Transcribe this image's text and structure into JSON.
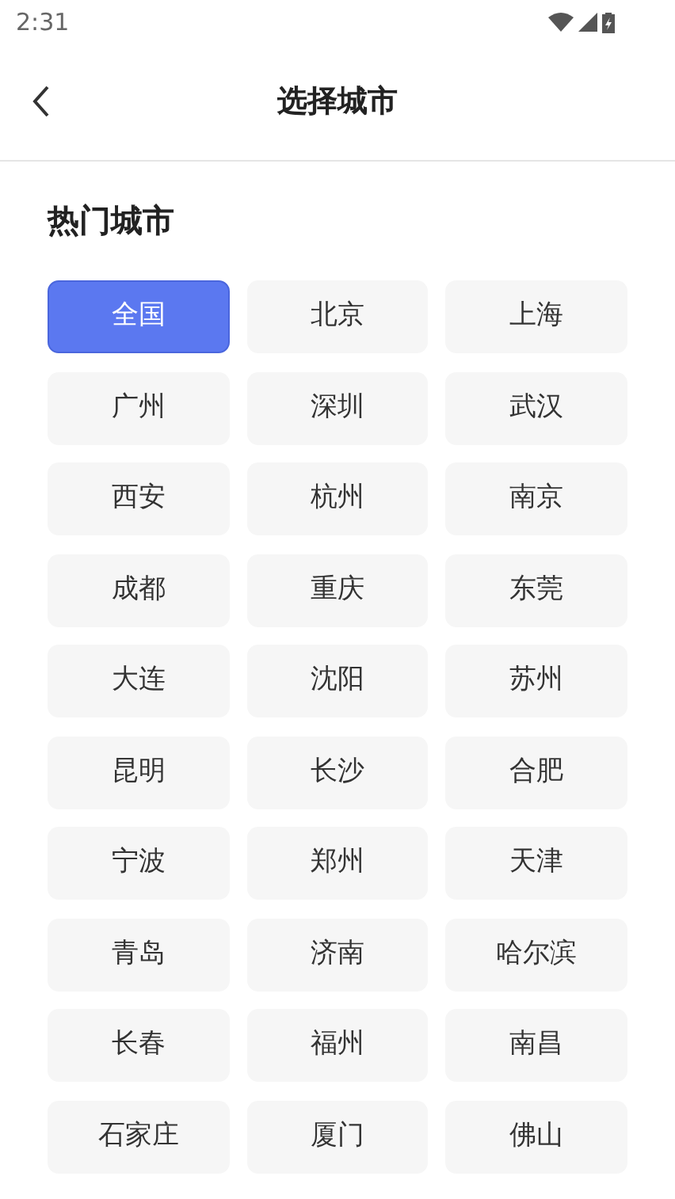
{
  "status_bar": {
    "time": "2:31"
  },
  "header": {
    "title": "选择城市"
  },
  "section": {
    "title": "热门城市"
  },
  "cities": [
    {
      "label": "全国",
      "selected": true
    },
    {
      "label": "北京",
      "selected": false
    },
    {
      "label": "上海",
      "selected": false
    },
    {
      "label": "广州",
      "selected": false
    },
    {
      "label": "深圳",
      "selected": false
    },
    {
      "label": "武汉",
      "selected": false
    },
    {
      "label": "西安",
      "selected": false
    },
    {
      "label": "杭州",
      "selected": false
    },
    {
      "label": "南京",
      "selected": false
    },
    {
      "label": "成都",
      "selected": false
    },
    {
      "label": "重庆",
      "selected": false
    },
    {
      "label": "东莞",
      "selected": false
    },
    {
      "label": "大连",
      "selected": false
    },
    {
      "label": "沈阳",
      "selected": false
    },
    {
      "label": "苏州",
      "selected": false
    },
    {
      "label": "昆明",
      "selected": false
    },
    {
      "label": "长沙",
      "selected": false
    },
    {
      "label": "合肥",
      "selected": false
    },
    {
      "label": "宁波",
      "selected": false
    },
    {
      "label": "郑州",
      "selected": false
    },
    {
      "label": "天津",
      "selected": false
    },
    {
      "label": "青岛",
      "selected": false
    },
    {
      "label": "济南",
      "selected": false
    },
    {
      "label": "哈尔滨",
      "selected": false
    },
    {
      "label": "长春",
      "selected": false
    },
    {
      "label": "福州",
      "selected": false
    },
    {
      "label": "南昌",
      "selected": false
    },
    {
      "label": "石家庄",
      "selected": false
    },
    {
      "label": "厦门",
      "selected": false
    },
    {
      "label": "佛山",
      "selected": false
    }
  ]
}
